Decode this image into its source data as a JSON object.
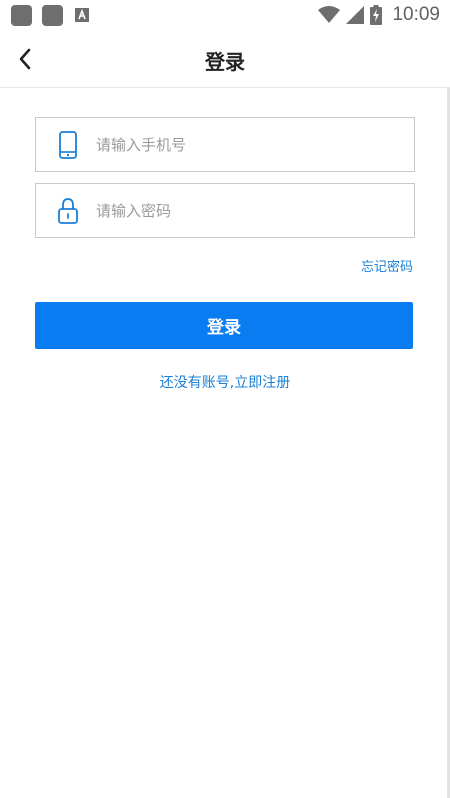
{
  "status_bar": {
    "time": "10:09",
    "icons": [
      "notification-square-icon",
      "notification-square-icon",
      "font-icon",
      "wifi-icon",
      "cellular-signal-icon",
      "battery-charging-icon"
    ]
  },
  "header": {
    "title": "登录",
    "back_icon": "chevron-left-icon"
  },
  "form": {
    "phone": {
      "placeholder": "请输入手机号",
      "value": "",
      "icon": "phone-icon"
    },
    "password": {
      "placeholder": "请输入密码",
      "value": "",
      "icon": "lock-icon"
    },
    "forgot_label": "忘记密码",
    "login_label": "登录",
    "register_label": "还没有账号,立即注册"
  },
  "colors": {
    "accent": "#0a7cf2",
    "link": "#1a7fd6",
    "border": "#c8c8c8"
  }
}
